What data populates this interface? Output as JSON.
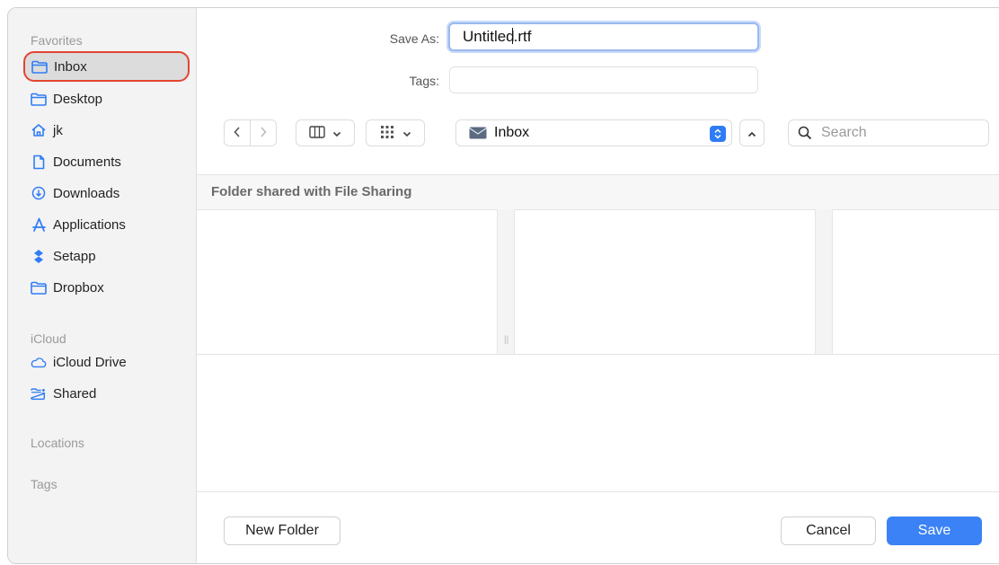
{
  "sidebar": {
    "sections": {
      "favorites": "Favorites",
      "icloud": "iCloud",
      "locations": "Locations",
      "tags": "Tags"
    },
    "favorites": [
      {
        "label": "Inbox",
        "icon": "folder-icon",
        "selected": true
      },
      {
        "label": "Desktop",
        "icon": "folder-icon"
      },
      {
        "label": "jk",
        "icon": "home-icon"
      },
      {
        "label": "Documents",
        "icon": "document-icon"
      },
      {
        "label": "Downloads",
        "icon": "download-icon"
      },
      {
        "label": "Applications",
        "icon": "applications-icon"
      },
      {
        "label": "Setapp",
        "icon": "setapp-icon"
      },
      {
        "label": "Dropbox",
        "icon": "folder-icon"
      }
    ],
    "icloud": [
      {
        "label": "iCloud Drive",
        "icon": "cloud-icon"
      },
      {
        "label": "Shared",
        "icon": "shared-folder-icon"
      }
    ]
  },
  "form": {
    "save_as_label": "Save As:",
    "save_as_value_before_cursor": "Untitled",
    "save_as_value_after_cursor": ".rtf",
    "tags_label": "Tags:",
    "tags_value": ""
  },
  "toolbar": {
    "location": "Inbox",
    "search_placeholder": "Search"
  },
  "browser": {
    "header": "Folder shared with File Sharing"
  },
  "buttons": {
    "new_folder": "New Folder",
    "cancel": "Cancel",
    "save": "Save"
  },
  "colors": {
    "accent": "#3b82f6",
    "highlight": "#e2442f",
    "icon_blue": "#2f7cf6"
  }
}
